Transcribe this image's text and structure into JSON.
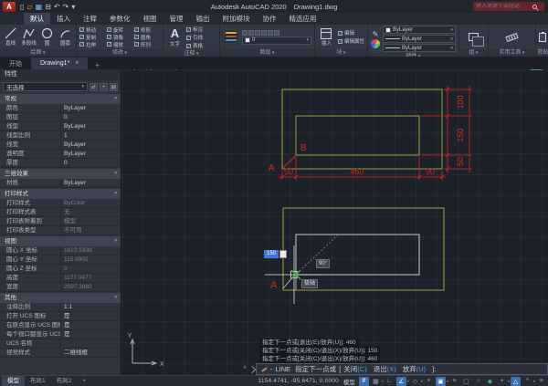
{
  "title_bar": {
    "app_title": "Autodesk AutoCAD 2020",
    "doc_name": "Drawing1.dwg",
    "search_placeholder": "键入关键字或短语",
    "qat_icons": [
      "▯",
      "▱",
      "▦",
      "⊟",
      "↶",
      "↷",
      "▾"
    ]
  },
  "ribbon": {
    "active_tab": "默认",
    "other_tabs": [
      "插入",
      "注释",
      "参数化",
      "视图",
      "管理",
      "输出",
      "附加模块",
      "协作",
      "精选应用"
    ],
    "panels": {
      "draw": {
        "label": "绘图",
        "items": [
          "直线",
          "多段线",
          "圆",
          "圆弧"
        ]
      },
      "modify": {
        "label": "修改",
        "items": [
          "移动",
          "旋转",
          "修剪",
          "复制",
          "镜像",
          "圆角",
          "拉伸",
          "缩放",
          "阵列"
        ]
      },
      "annotate": {
        "label": "注释",
        "items": [
          "文字",
          "标注",
          "引线",
          "表格"
        ],
        "text_glyph": "A"
      },
      "layers": {
        "label": "图层",
        "current_layer": "0"
      },
      "block": {
        "label": "块",
        "items": [
          "插入",
          "编辑",
          "编辑属性"
        ]
      },
      "properties": {
        "label": "特性",
        "values": [
          "ByLayer",
          "ByLayer",
          "ByLayer"
        ]
      },
      "group": {
        "label": "组"
      },
      "utilities": {
        "label": "实用工具"
      },
      "clipboard": {
        "label": "剪贴板"
      }
    }
  },
  "file_tabs": {
    "start": "开始",
    "doc": "Drawing1*"
  },
  "icons": {
    "close": "×",
    "plus": "+"
  },
  "viewport_controls": [
    "[-]",
    "[俯视]",
    "[二维线框]"
  ],
  "palette": {
    "title": "特性",
    "selector": "无选择",
    "tool_icons": [
      "⇄",
      "+",
      "▤"
    ],
    "sections": [
      {
        "name": "常规",
        "rows": [
          {
            "l": "颜色",
            "v": "ByLayer"
          },
          {
            "l": "图层",
            "v": "0"
          },
          {
            "l": "线型",
            "v": "ByLayer"
          },
          {
            "l": "线型比例",
            "v": "1"
          },
          {
            "l": "线宽",
            "v": "ByLayer"
          },
          {
            "l": "透明度",
            "v": "ByLayer"
          },
          {
            "l": "厚度",
            "v": "0"
          }
        ]
      },
      {
        "name": "三维效果",
        "rows": [
          {
            "l": "材质",
            "v": "ByLayer"
          }
        ]
      },
      {
        "name": "打印样式",
        "rows": [
          {
            "l": "打印样式",
            "v": "ByColor"
          },
          {
            "l": "打印样式表",
            "v": "无"
          },
          {
            "l": "打印表附着到",
            "v": "模型"
          },
          {
            "l": "打印表类型",
            "v": "不可用"
          }
        ]
      },
      {
        "name": "视图",
        "rows": [
          {
            "l": "圆心 X 坐标",
            "v": "1623.5338"
          },
          {
            "l": "圆心 Y 坐标",
            "v": "115.9902"
          },
          {
            "l": "圆心 Z 坐标",
            "v": "0"
          },
          {
            "l": "高度",
            "v": "1177.0477"
          },
          {
            "l": "宽度",
            "v": "2597.3882"
          }
        ]
      },
      {
        "name": "其他",
        "rows": [
          {
            "l": "注释比例",
            "v": "1:1"
          },
          {
            "l": "打开 UCS 图标",
            "v": "是"
          },
          {
            "l": "在原点显示 UCS 图标",
            "v": "是"
          },
          {
            "l": "每个视口都显示 UCS",
            "v": "是"
          },
          {
            "l": "UCS 名称",
            "v": ""
          },
          {
            "l": "视觉样式",
            "v": "二维线框"
          }
        ]
      }
    ]
  },
  "drawing": {
    "point_a_top": "A",
    "point_b": "B",
    "point_a_bottom": "A",
    "dim_bottom": [
      "50",
      "460",
      "90"
    ],
    "dim_right": [
      "100",
      "150",
      "50"
    ],
    "angle_tooltip": "90°",
    "polar_tooltip": "极轴",
    "dyn_value": "150",
    "ucs_x": "X",
    "ucs_y": "Y"
  },
  "command": {
    "history": [
      "指定下一点或[退出(E)/放弃(U)]: 460",
      "指定下一点或[关闭(C)/退出(X)/放弃(U)]: 150",
      "指定下一点或[关闭(C)/退出(X)/放弃(U)]: 460"
    ],
    "prefix": "-",
    "name": "LINE",
    "prompt": "指定下一点或",
    "bracket_open": "[",
    "opts": [
      {
        "t": "关闭",
        "k": "(C)"
      },
      {
        "t": "退出",
        "k": "(X)"
      },
      {
        "t": "放弃",
        "k": "(U)"
      }
    ],
    "bracket_close": "]:"
  },
  "status_bar": {
    "coords": "1154.4741, -95.6471, 0.0000",
    "model": "模型",
    "icons": [
      "#",
      "▦",
      "∟",
      "∠",
      "◇",
      "×",
      "▣",
      "≡",
      "▢",
      "○",
      "◆",
      "+",
      "△",
      "*",
      "≡"
    ]
  },
  "layout_tabs": {
    "active": "模型",
    "others": [
      "布局1",
      "布局2"
    ]
  },
  "colors": {
    "accent_blue": "#3d6fae",
    "dim_red": "#d42626",
    "shape_green": "#95a23c"
  }
}
